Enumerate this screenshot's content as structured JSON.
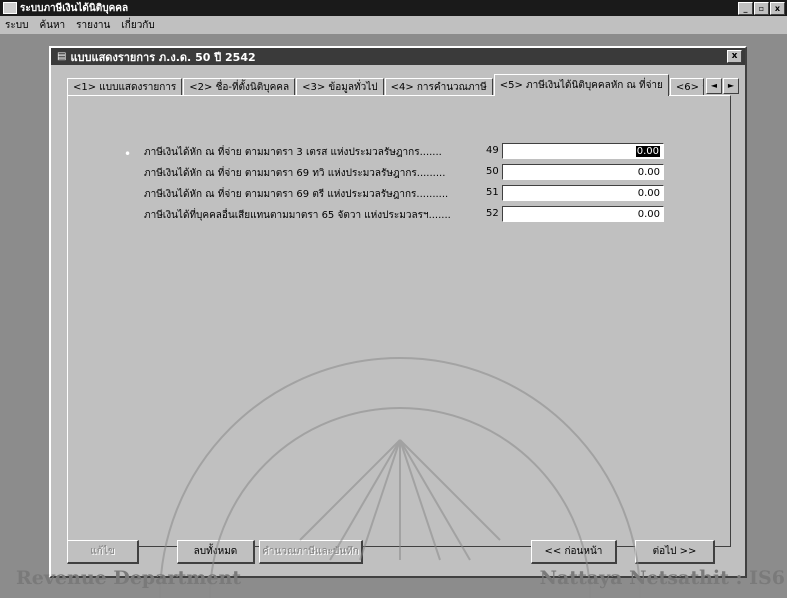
{
  "app": {
    "title": "ระบบภาษีเงินได้นิติบุคคล",
    "min_symbol": "_",
    "max_symbol": "▫",
    "close_symbol": "x"
  },
  "menu": [
    "ระบบ",
    "ค้นหา",
    "รายงาน",
    "เกี่ยวกับ"
  ],
  "window": {
    "title": "แบบแสดงรายการ ภ.ง.ด. 50 ปี 2542",
    "close_symbol": "x"
  },
  "tabs": [
    "<1> แบบแสดงรายการ",
    "<2> ชื่อ-ที่ตั้งนิติบุคคล",
    "<3> ข้อมูลทั่วไป",
    "<4> การคำนวณภาษี",
    "<5> ภาษีเงินได้นิติบุคคลหัก ณ ที่จ่าย",
    "<6> รายไ"
  ],
  "active_tab_index": 4,
  "tab_scroll": {
    "left": "◄",
    "right": "►"
  },
  "rows": [
    {
      "label": "ภาษีเงินได้หัก ณ ที่จ่าย ตามมาตรา 3 เตรส แห่งประมวลรัษฎากร.......",
      "num": "49",
      "value": "0.00",
      "selected": true
    },
    {
      "label": "ภาษีเงินได้หัก ณ ที่จ่าย ตามมาตรา 69 ทวิ แห่งประมวลรัษฎากร.........",
      "num": "50",
      "value": "0.00",
      "selected": false
    },
    {
      "label": "ภาษีเงินได้หัก ณ ที่จ่าย ตามมาตรา 69 ตรี แห่งประมวลรัษฎากร..........",
      "num": "51",
      "value": "0.00",
      "selected": false
    },
    {
      "label": "ภาษีเงินได้ที่บุคคลอื่นเสียแทนตามมาตรา 65 จัตวา แห่งประมวลรฯ.......",
      "num": "52",
      "value": "0.00",
      "selected": false
    }
  ],
  "buttons": {
    "edit": "แก้ไข",
    "save_all": "ลบทั้งหมด",
    "calculate": "คำนวณภาษีและบันทึก",
    "prev": "<< ก่อนหน้า",
    "next": "ต่อไป >>"
  },
  "watermark": {
    "left": "Revenue Department",
    "right": "Nattaya Netsathit : IS6"
  }
}
